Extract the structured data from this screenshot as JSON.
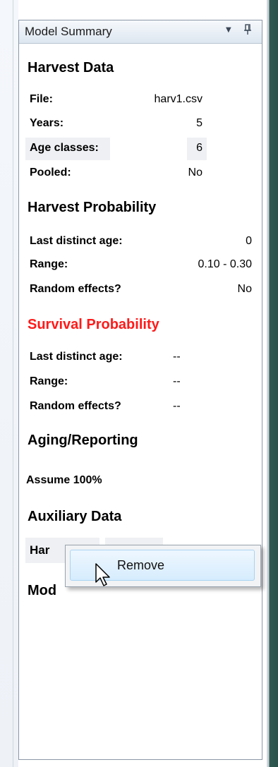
{
  "panel": {
    "title": "Model Summary",
    "dropdown_icon": "chevron-down-icon",
    "pin_icon": "pin-icon"
  },
  "harvest_data": {
    "title": "Harvest Data",
    "rows": [
      {
        "label": "File:",
        "value": "harv1.csv"
      },
      {
        "label": "Years:",
        "value": "5"
      },
      {
        "label": "Age classes:",
        "value": "6"
      },
      {
        "label": "Pooled:",
        "value": "No"
      }
    ]
  },
  "harvest_probability": {
    "title": "Harvest Probability",
    "rows": [
      {
        "label": "Last distinct age:",
        "value": "0"
      },
      {
        "label": "Range:",
        "value": "0.10 - 0.30"
      },
      {
        "label": "Random effects?",
        "value": "No"
      }
    ]
  },
  "survival_probability": {
    "title": "Survival Probability",
    "title_color": "#ff1a1a",
    "rows": [
      {
        "label": "Last distinct age:",
        "value": "--"
      },
      {
        "label": "Range:",
        "value": "--"
      },
      {
        "label": "Random effects?",
        "value": "--"
      }
    ]
  },
  "aging_reporting": {
    "title": "Aging/Reporting",
    "text": "Assume 100%"
  },
  "auxiliary_data": {
    "title": "Auxiliary Data",
    "item_partial": "Har"
  },
  "model": {
    "title_partial": "Mod"
  },
  "context_menu": {
    "items": [
      {
        "label": "Remove"
      }
    ]
  }
}
